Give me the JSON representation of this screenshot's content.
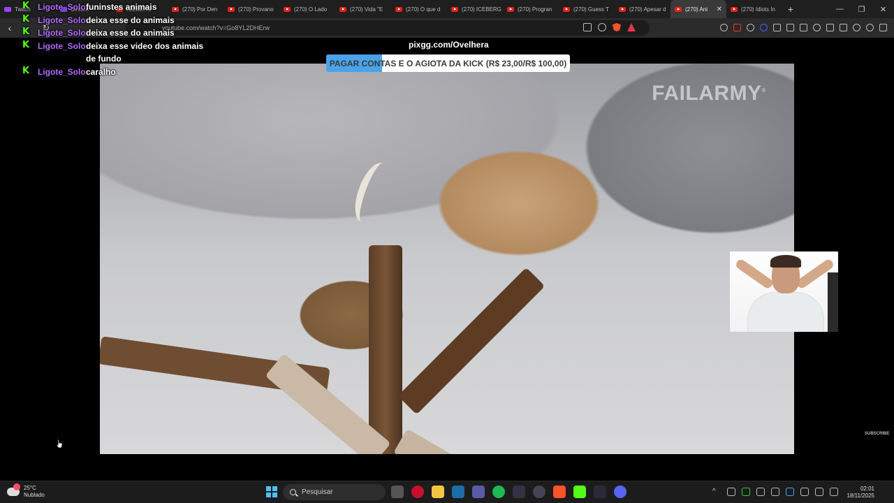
{
  "browser": {
    "tabs": [
      {
        "label": "Twitch",
        "type": "twitch"
      },
      {
        "label": "Stream",
        "type": "twitch"
      },
      {
        "label": "ICEBERG",
        "type": "yt"
      },
      {
        "label": "(270) Por Den",
        "type": "yt"
      },
      {
        "label": "(270) Provano",
        "type": "yt"
      },
      {
        "label": "(270) O Lado",
        "type": "yt"
      },
      {
        "label": "(270) Vida \"E",
        "type": "yt"
      },
      {
        "label": "(270) O que d",
        "type": "yt"
      },
      {
        "label": "(270) ICEBERG",
        "type": "yt"
      },
      {
        "label": "(270) Progran",
        "type": "yt"
      },
      {
        "label": "(270) Guess T",
        "type": "yt"
      },
      {
        "label": "(270) Apesar d",
        "type": "yt"
      },
      {
        "label": "(270) Ani",
        "type": "yt",
        "active": true
      },
      {
        "label": "(270) Idiots In",
        "type": "yt"
      }
    ],
    "url": "youtube.com/watch?v=Go8YL2DHErw"
  },
  "stream": {
    "overlay_url": "pixgg.com/Ovelhera",
    "goal": {
      "text": "PAGAR CONTAS E O AGIOTA DA KICK (R$ 23,00/R$ 100,00)",
      "progress": 0.23,
      "fill_color": "#4aa3ea"
    },
    "watermark": "FAILARMY",
    "watermark_mark": "®",
    "subscribe": "SUBSCRIBE"
  },
  "chat": {
    "username_color": "#b36bff",
    "badge_color": "#53fc18",
    "messages": [
      {
        "user": "Ligote_Solo",
        "text": "funinstes animais"
      },
      {
        "user": "Ligote_Solo",
        "text": "deixa esse do animais"
      },
      {
        "user": "Ligote_Solo",
        "text": "deixa esse do animais"
      },
      {
        "user": "Ligote_Solo",
        "text": "deixa esse video dos animais de fundo"
      },
      {
        "user": "Ligote_Solo",
        "text": "caralho"
      }
    ]
  },
  "taskbar": {
    "weather_temp": "25°C",
    "weather_desc": "Nublado",
    "search_placeholder": "Pesquisar",
    "time": "02:01",
    "date": "18/11/2025"
  }
}
